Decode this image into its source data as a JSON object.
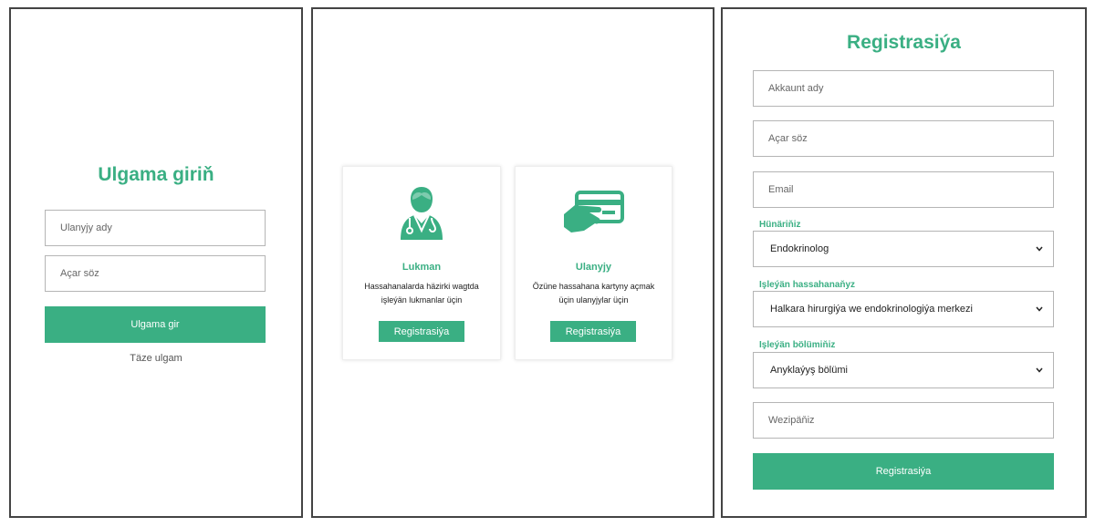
{
  "colors": {
    "accent": "#3aaf83",
    "border": "#444444"
  },
  "login": {
    "title": "Ulgama giriň",
    "username_placeholder": "Ulanyjy ady",
    "password_placeholder": "Açar söz",
    "submit_label": "Ulgama gir",
    "new_account_link": "Täze ulgam"
  },
  "choose": {
    "cards": [
      {
        "icon": "doctor-icon",
        "title": "Lukman",
        "desc_line1": "Hassahanalarda häzirki wagtda",
        "desc_line2": "işleýän lukmanlar üçin",
        "button": "Registrasiýa"
      },
      {
        "icon": "card-hand-icon",
        "title": "Ulanyjy",
        "desc_line1": "Özüne hassahana kartyny açmak",
        "desc_line2": "üçin ulanyjylar üçin",
        "button": "Registrasiýa"
      }
    ]
  },
  "register": {
    "title": "Registrasiýa",
    "account_placeholder": "Akkaunt ady",
    "password_placeholder": "Açar söz",
    "email_placeholder": "Email",
    "profession_label": "Hünäriňiz",
    "profession_value": "Endokrinolog",
    "hospital_label": "Işleýän hassahanaňyz",
    "hospital_value": "Halkara hirurgiýa we endokrinologiýa merkezi",
    "department_label": "Işleýän bölümiňiz",
    "department_value": "Anyklaýyş bölümi",
    "position_placeholder": "Wezipäňiz",
    "submit_label": "Registrasiýa"
  }
}
